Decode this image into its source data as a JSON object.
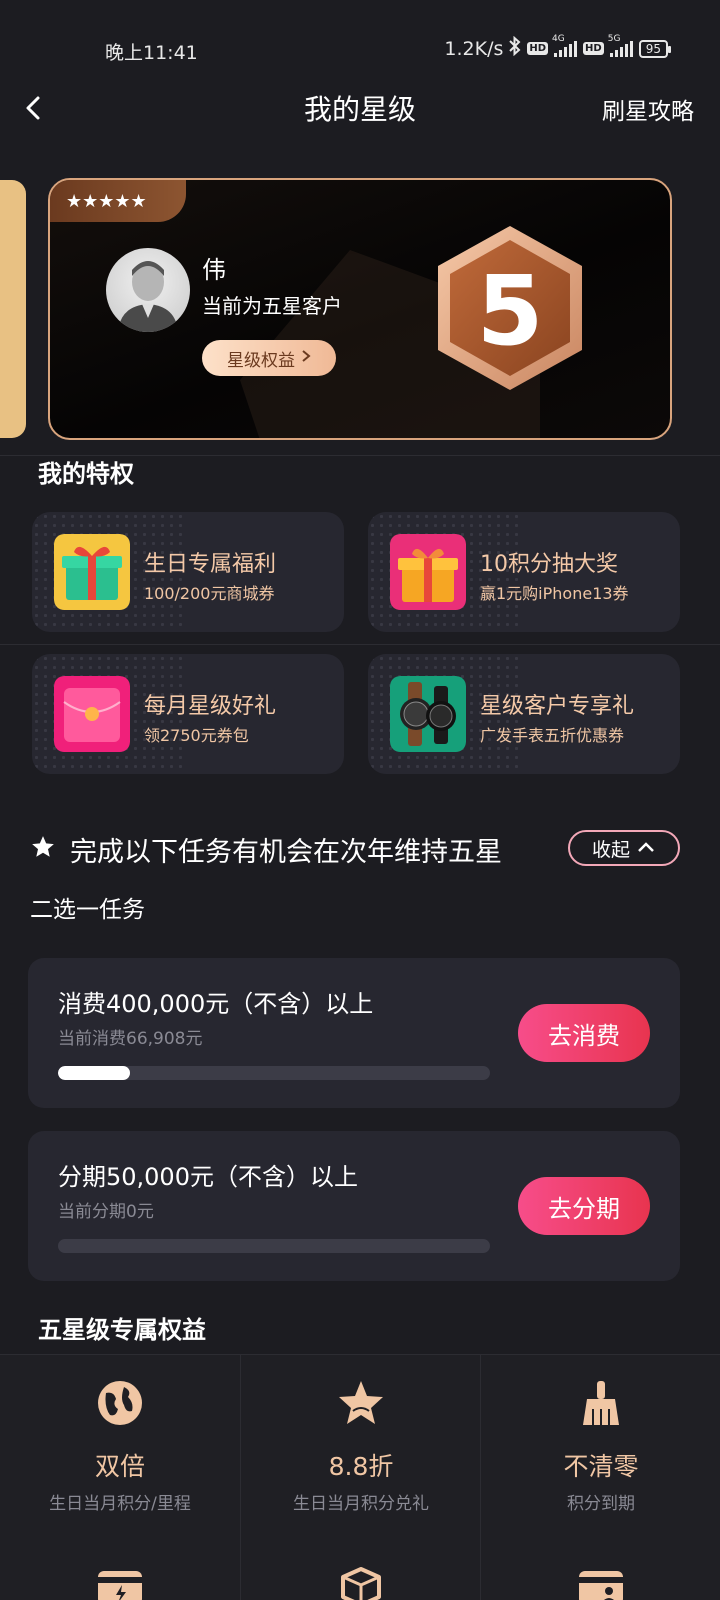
{
  "status_bar": {
    "time": "晚上11:41",
    "speed": "1.2K/s",
    "hd1": "HD",
    "net1": "4G",
    "hd2": "HD",
    "net2": "5G",
    "battery": "95"
  },
  "header": {
    "title": "我的星级",
    "right_link": "刷星攻略"
  },
  "star_card": {
    "stars": "★★★★★",
    "user_name": "伟",
    "level_text": "当前为五星客户",
    "benefit_button": "星级权益",
    "badge_number": "5"
  },
  "privileges": {
    "title": "我的特权",
    "items": [
      {
        "title": "生日专属福利",
        "subtitle": "100/200元商城券",
        "icon": "gift-box-icon"
      },
      {
        "title": "10积分抽大奖",
        "subtitle": "赢1元购iPhone13券",
        "icon": "prize-box-icon"
      },
      {
        "title": "每月星级好礼",
        "subtitle": "领2750元券包",
        "icon": "red-envelope-icon"
      },
      {
        "title": "星级客户专享礼",
        "subtitle": "广发手表五折优惠券",
        "icon": "watch-icon"
      }
    ]
  },
  "tasks": {
    "heading": "完成以下任务有机会在次年维持五星",
    "collapse_label": "收起",
    "subheading": "二选一任务",
    "items": [
      {
        "title": "消费400,000元（不含）以上",
        "progress_text": "当前消费66,908元",
        "progress": 0.167,
        "button": "去消费"
      },
      {
        "title": "分期50,000元（不含）以上",
        "progress_text": "当前分期0元",
        "progress": 0,
        "button": "去分期"
      }
    ]
  },
  "benefits": {
    "title": "五星级专属权益",
    "items": [
      {
        "title": "双倍",
        "subtitle": "生日当月积分/里程",
        "icon": "globe-icon"
      },
      {
        "title": "8.8折",
        "subtitle": "生日当月积分兑礼",
        "icon": "star-icon"
      },
      {
        "title": "不清零",
        "subtitle": "积分到期",
        "icon": "broom-icon"
      }
    ],
    "more_icons": [
      "card-lightning-icon",
      "package-icon",
      "card-person-icon"
    ]
  },
  "colors": {
    "background": "#1c1c21",
    "card": "#272730",
    "accent_text": "#f0c6a4",
    "button": "#f74d8a",
    "gold": "#d9a47d"
  }
}
